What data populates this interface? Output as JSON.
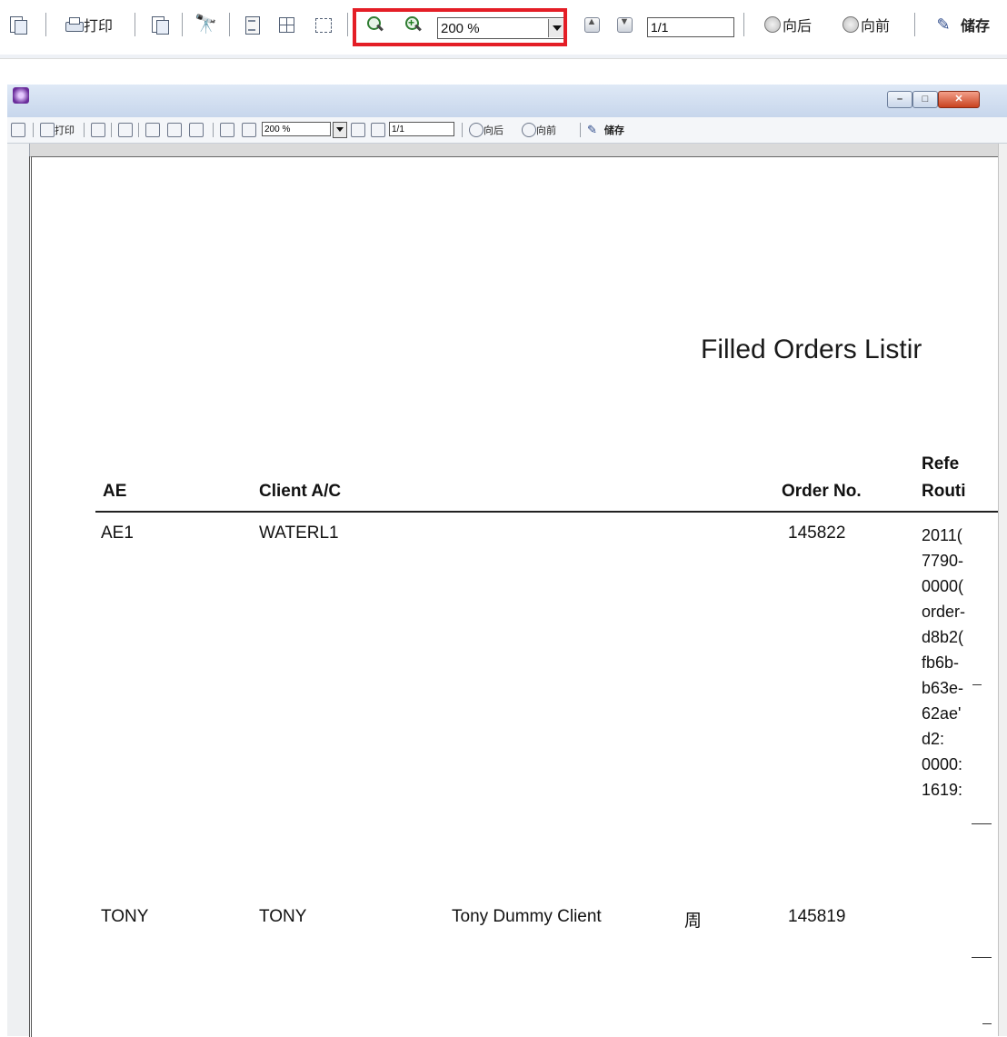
{
  "toolbar": {
    "print_label": "打印",
    "zoom_value": "200 %",
    "page_value": "1/1",
    "back_label": "向后",
    "forward_label": "向前",
    "save_label": "储存"
  },
  "window": {
    "mini_toolbar": {
      "print_label": "打印",
      "zoom_value": "200 %",
      "page_value": "1/1",
      "back_label": "向后",
      "forward_label": "向前",
      "save_label": "储存"
    }
  },
  "report": {
    "title": "Filled Orders Listir",
    "columns": {
      "ae": "AE",
      "client": "Client A/C",
      "order_no": "Order No.",
      "ref_line1": "Refe",
      "ref_line2": "Routi"
    },
    "rows": [
      {
        "ae": "AE1",
        "client": "WATERL1",
        "client_name": "",
        "client_extra": "",
        "order_no": "145822",
        "ref_lines": [
          "2011(",
          "7790-",
          "0000(",
          "order-",
          "d8b2(",
          "fb6b-",
          "b63e-",
          "62ae'",
          "d2:",
          "0000:",
          "1619:"
        ]
      },
      {
        "ae": "TONY",
        "client": "TONY",
        "client_name": "Tony Dummy Client",
        "client_extra": "周",
        "order_no": "145819",
        "ref_lines": []
      }
    ]
  },
  "icons": {
    "copy": "copy-icon",
    "print": "printer-icon",
    "find": "binoculars-icon",
    "page_single": "single-page-icon",
    "page_multi": "multi-page-icon",
    "page_cont": "continuous-page-icon",
    "zoom_out": "zoom-out-icon",
    "zoom_in": "zoom-in-icon",
    "first": "first-page-icon",
    "last": "last-page-icon",
    "back": "back-icon",
    "forward": "forward-icon",
    "save": "save-icon"
  }
}
